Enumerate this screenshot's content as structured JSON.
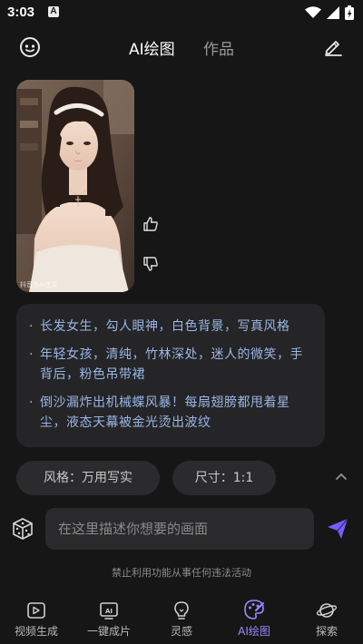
{
  "status_bar": {
    "time": "3:03",
    "badge": "A"
  },
  "header": {
    "tabs": [
      "AI绘图",
      "作品"
    ],
    "active_tab": "AI绘图"
  },
  "result": {
    "watermark": "抖音由AI生成"
  },
  "suggestions": [
    "长发女生，勾人眼神，白色背景，写真风格",
    "年轻女孩，清纯，竹林深处，迷人的微笑，手背后，粉色吊带裙",
    "倒沙漏炸出机械蝶风暴！每扇翅膀都甩着星尘，液态天幕被金光烫出波纹"
  ],
  "options": {
    "style": "风格：万用写实",
    "size": "尺寸：1:1"
  },
  "prompt_input": {
    "placeholder": "在这里描述你想要的画面",
    "value": ""
  },
  "disclaimer": "禁止利用功能从事任何违法活动",
  "bottom_nav": [
    {
      "label": "视频生成",
      "icon": "video-generate-icon"
    },
    {
      "label": "一键成片",
      "icon": "ai-clip-icon"
    },
    {
      "label": "灵感",
      "icon": "lightbulb-icon"
    },
    {
      "label": "AI绘图",
      "icon": "palette-icon",
      "active": true
    },
    {
      "label": "探索",
      "icon": "planet-icon"
    }
  ],
  "colors": {
    "background": "#161616",
    "accent": "#9b88ff",
    "suggestion_text": "#9ab6e6",
    "send": "#7b5cff"
  }
}
